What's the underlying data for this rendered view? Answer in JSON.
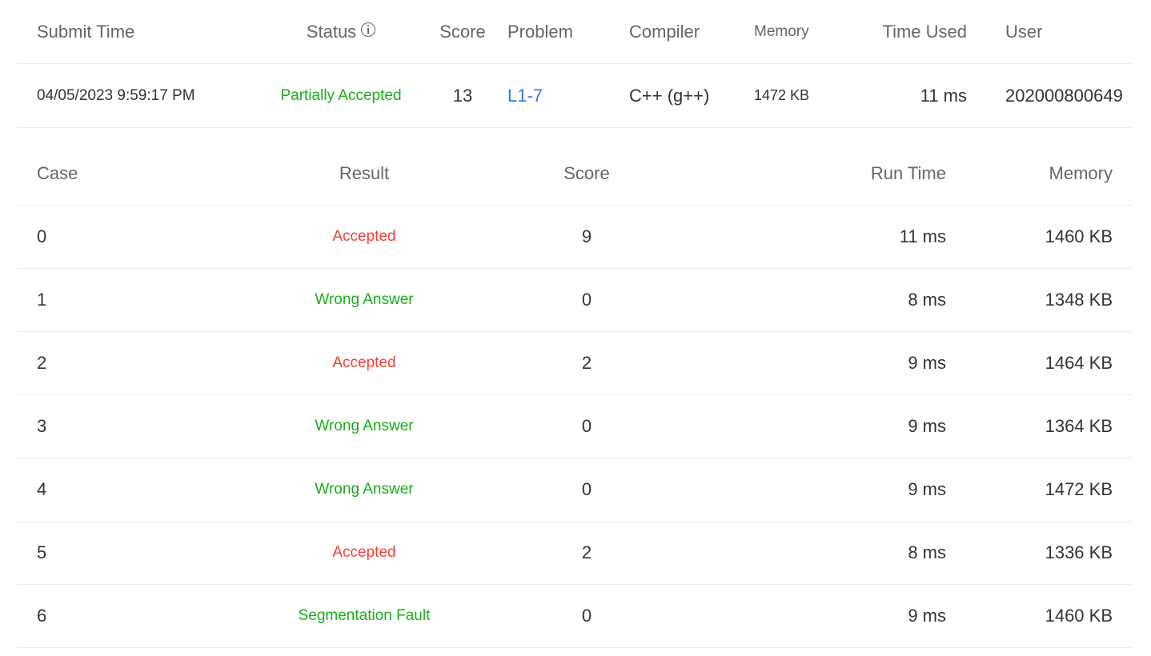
{
  "submission": {
    "headers": {
      "submit_time": "Submit Time",
      "status": "Status",
      "score": "Score",
      "problem": "Problem",
      "compiler": "Compiler",
      "memory": "Memory",
      "time_used": "Time Used",
      "user": "User"
    },
    "status_icon": "info-circle-icon",
    "row": {
      "submit_time": "04/05/2023 9:59:17 PM",
      "status": "Partially Accepted",
      "score": "13",
      "problem": "L1-7",
      "compiler": "C++ (g++)",
      "memory": "1472 KB",
      "time_used": "11 ms",
      "user": "202000800649"
    }
  },
  "cases": {
    "headers": {
      "case": "Case",
      "result": "Result",
      "score": "Score",
      "run_time": "Run Time",
      "memory": "Memory"
    },
    "rows": [
      {
        "case": "0",
        "result": "Accepted",
        "score": "9",
        "run_time": "11 ms",
        "memory": "1460 KB"
      },
      {
        "case": "1",
        "result": "Wrong Answer",
        "score": "0",
        "run_time": "8 ms",
        "memory": "1348 KB"
      },
      {
        "case": "2",
        "result": "Accepted",
        "score": "2",
        "run_time": "9 ms",
        "memory": "1464 KB"
      },
      {
        "case": "3",
        "result": "Wrong Answer",
        "score": "0",
        "run_time": "9 ms",
        "memory": "1364 KB"
      },
      {
        "case": "4",
        "result": "Wrong Answer",
        "score": "0",
        "run_time": "9 ms",
        "memory": "1472 KB"
      },
      {
        "case": "5",
        "result": "Accepted",
        "score": "2",
        "run_time": "8 ms",
        "memory": "1336 KB"
      },
      {
        "case": "6",
        "result": "Segmentation Fault",
        "score": "0",
        "run_time": "9 ms",
        "memory": "1460 KB"
      }
    ]
  },
  "colors": {
    "accepted": "#f04134",
    "non_accepted": "#1aad19",
    "link": "#2f7ce0",
    "header_text": "#666666",
    "body_text": "#333333",
    "divider": "#ececec"
  }
}
